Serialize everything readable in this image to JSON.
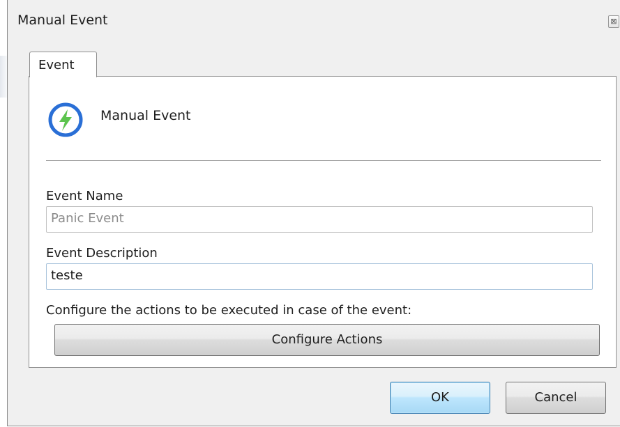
{
  "window": {
    "title": "Manual Event",
    "close_glyph": "⊠"
  },
  "tabs": [
    {
      "label": "Event",
      "selected": true
    }
  ],
  "event": {
    "icon": "lightning-bolt-icon",
    "type_label": "Manual Event",
    "icon_ring_color": "#2a6fd6",
    "icon_bolt_color": "#5cc44e"
  },
  "form": {
    "name_label": "Event Name",
    "name_value": "Panic Event",
    "description_label": "Event Description",
    "description_value": "teste",
    "actions_hint": "Configure the actions to be executed in case of the event:",
    "configure_button_label": "Configure Actions"
  },
  "footer": {
    "ok_label": "OK",
    "cancel_label": "Cancel"
  }
}
